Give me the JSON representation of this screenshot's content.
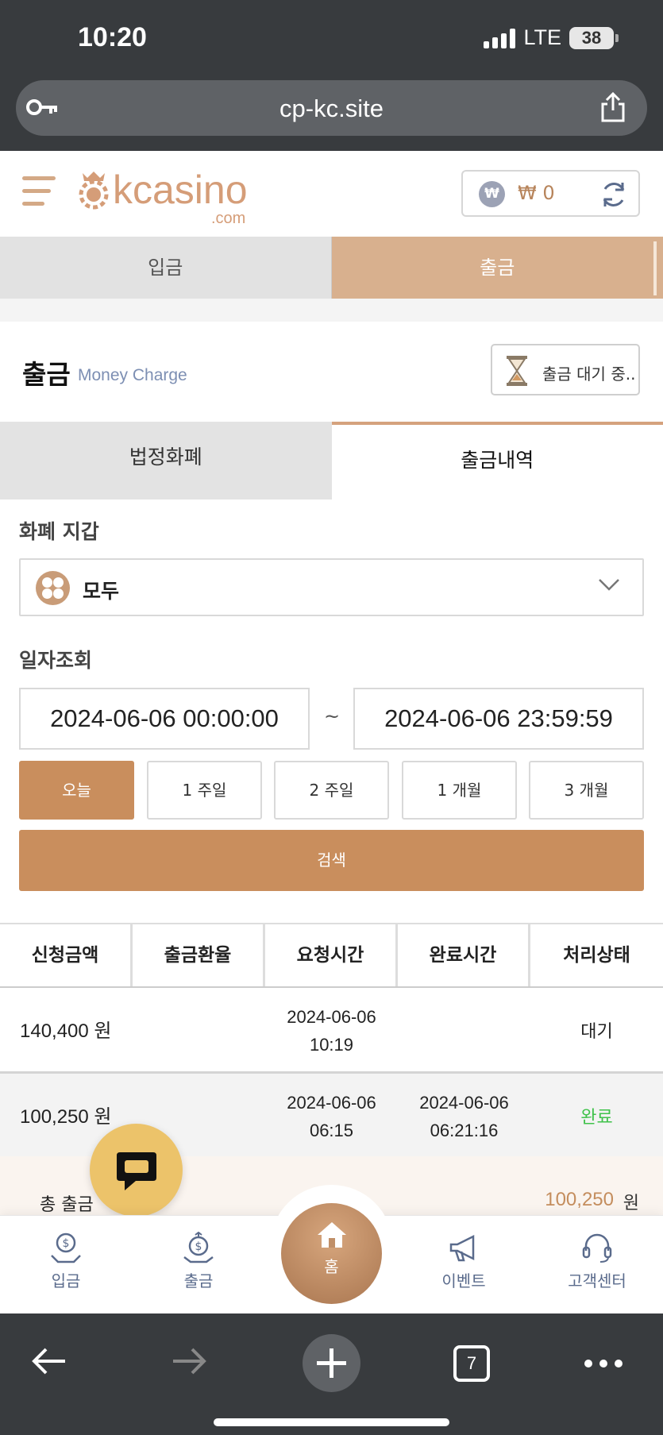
{
  "status_bar": {
    "time": "10:20",
    "network": "LTE",
    "battery": "38"
  },
  "browser": {
    "url": "cp-kc.site",
    "tab_count": "7"
  },
  "header": {
    "logo_text": "kcasino",
    "logo_suffix": ".com",
    "balance": "₩ 0",
    "currency_badge": "₩"
  },
  "top_tabs": {
    "deposit": "입금",
    "withdraw": "출금"
  },
  "section": {
    "title": "출금",
    "subtitle": "Money Charge",
    "pending_button": "출금 대기 중.."
  },
  "sub_tabs": {
    "fiat": "법정화폐",
    "history": "출금내역"
  },
  "filters": {
    "wallet_label": "화폐 지갑",
    "wallet_value": "모두",
    "date_label": "일자조회",
    "date_from": "2024-06-06 00:00:00",
    "date_separator": "~",
    "date_to": "2024-06-06 23:59:59",
    "ranges": [
      "오늘",
      "1 주일",
      "2 주일",
      "1 개월",
      "3 개월"
    ],
    "active_range": "오늘",
    "search_button": "검색"
  },
  "table": {
    "headers": [
      "신청금액",
      "출금환율",
      "요청시간",
      "완료시간",
      "처리상태"
    ],
    "rows": [
      {
        "amount": "140,400 원",
        "rate": "",
        "requested_date": "2024-06-06",
        "requested_time": "10:19",
        "completed_date": "",
        "completed_time": "",
        "status": "대기"
      },
      {
        "amount": "100,250 원",
        "rate": "",
        "requested_date": "2024-06-06",
        "requested_time": "06:15",
        "completed_date": "2024-06-06",
        "completed_time": "06:21:16",
        "status": "완료"
      }
    ],
    "total_label": "총 출금",
    "total_amount": "100,250",
    "total_unit": "원"
  },
  "bottom_nav": {
    "deposit": "입금",
    "withdraw": "출금",
    "home": "홈",
    "event": "이벤트",
    "support": "고객센터"
  },
  "colors": {
    "accent": "#c98e5d",
    "tab_active": "#d8b08e",
    "status_complete": "#3fc24a",
    "chrome": "#383b3e"
  }
}
